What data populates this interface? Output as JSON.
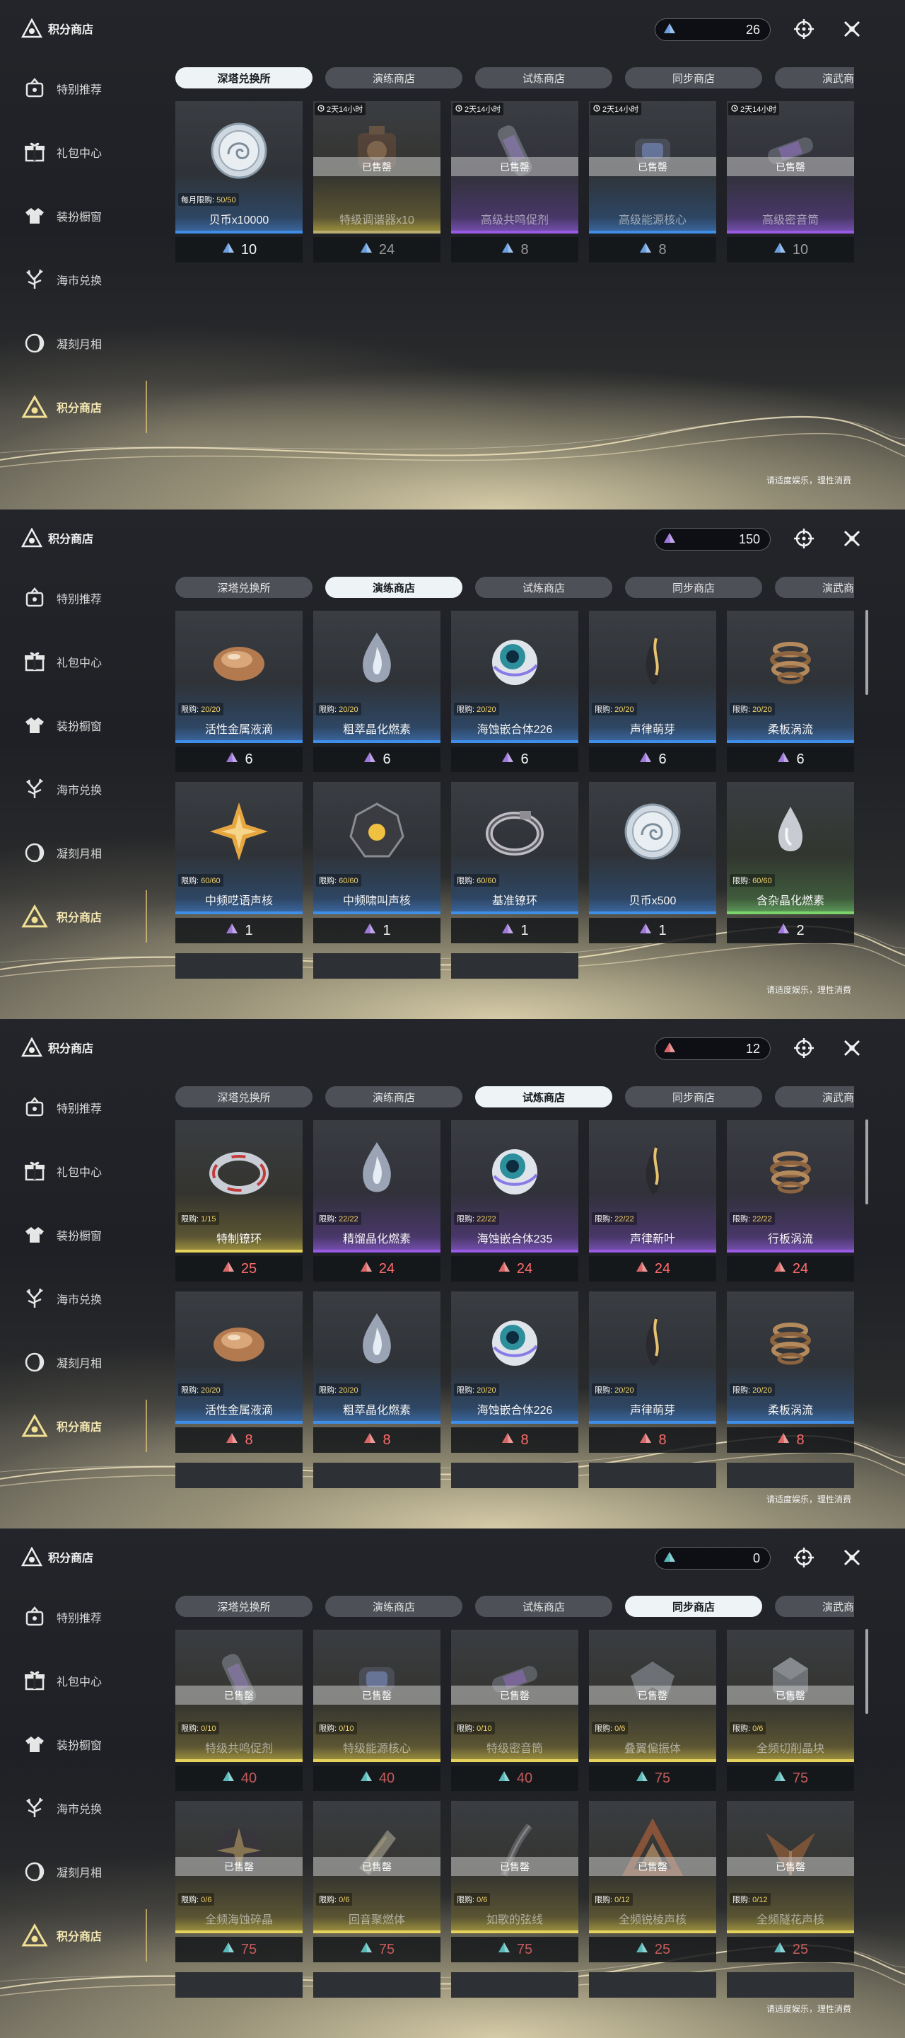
{
  "brand": {
    "title": "积分商店"
  },
  "sidebar": [
    {
      "key": "tuijian",
      "label": "特别推荐",
      "icon": "recommend-icon"
    },
    {
      "key": "libao",
      "label": "礼包中心",
      "icon": "gift-icon"
    },
    {
      "key": "zhuangban",
      "label": "装扮橱窗",
      "icon": "wardrobe-icon"
    },
    {
      "key": "haishi",
      "label": "海市兑换",
      "icon": "coral-icon"
    },
    {
      "key": "ningke",
      "label": "凝刻月相",
      "icon": "moon-phase-icon"
    },
    {
      "key": "jifen",
      "label": "积分商店",
      "icon": "points-store-icon"
    }
  ],
  "active_sidebar": "jifen",
  "tabs": [
    "深塔兑换所",
    "演练商店",
    "试炼商店",
    "同步商店",
    "演武商店"
  ],
  "footnote": "请适度娱乐，理性消费",
  "limit_label": "限购:",
  "sold_out_label": "已售罄",
  "panels": [
    {
      "currency": {
        "value": "26",
        "color": "#6fa6ec",
        "icon": "crystal-blue-icon"
      },
      "active_tab": 0,
      "has_scrollbar": false,
      "items": [
        {
          "name": "贝币x10000",
          "limit_prefix": "每月限购:",
          "limit": "50/50",
          "price": "10",
          "tint": "blue",
          "icon": "coin-icon",
          "sold": false
        },
        {
          "name": "特级调谐器x10",
          "timer": "2天14小时",
          "price": "24",
          "tint": "gray",
          "icon": "tuner-icon",
          "sold": true
        },
        {
          "name": "高级共鸣促剂",
          "timer": "2天14小时",
          "price": "8",
          "tint": "purple",
          "icon": "tube-icon",
          "sold": true
        },
        {
          "name": "高级能源核心",
          "timer": "2天14小时",
          "price": "8",
          "tint": "blue",
          "icon": "core-icon",
          "sold": true
        },
        {
          "name": "高级密音筒",
          "timer": "2天14小时",
          "price": "10",
          "tint": "purple",
          "icon": "cylinder-icon",
          "sold": true
        }
      ]
    },
    {
      "currency": {
        "value": "150",
        "color": "#a77de6",
        "icon": "crystal-purple-icon"
      },
      "active_tab": 1,
      "has_scrollbar": true,
      "items": [
        {
          "name": "活性金属液滴",
          "limit": "20/20",
          "price": "6",
          "tint": "blue",
          "icon": "metal-drop-icon"
        },
        {
          "name": "粗萃晶化燃素",
          "limit": "20/20",
          "price": "6",
          "tint": "blue",
          "icon": "flame-drop-icon"
        },
        {
          "name": "海蚀嵌合体226",
          "limit": "20/20",
          "price": "6",
          "tint": "blue",
          "icon": "orb-icon"
        },
        {
          "name": "声律萌芽",
          "limit": "20/20",
          "price": "6",
          "tint": "blue",
          "icon": "sprout-icon"
        },
        {
          "name": "柔板涡流",
          "limit": "20/20",
          "price": "6",
          "tint": "blue",
          "icon": "vortex-icon"
        },
        {
          "name": "中频呓语声核",
          "limit": "60/60",
          "price": "1",
          "tint": "blue",
          "icon": "star-core-icon"
        },
        {
          "name": "中频啸叫声核",
          "limit": "60/60",
          "price": "1",
          "tint": "blue",
          "icon": "dark-core-icon"
        },
        {
          "name": "基准镣环",
          "limit": "60/60",
          "price": "1",
          "tint": "blue",
          "icon": "ring-icon"
        },
        {
          "name": "贝币x500",
          "limit": "",
          "price": "1",
          "tint": "blue",
          "icon": "coin-icon"
        },
        {
          "name": "含杂晶化燃素",
          "limit": "60/60",
          "price": "2",
          "tint": "green",
          "icon": "drop-icon"
        }
      ],
      "stubs": 3
    },
    {
      "currency": {
        "value": "12",
        "color": "#e66a6a",
        "icon": "crystal-red-icon"
      },
      "active_tab": 2,
      "has_scrollbar": true,
      "items": [
        {
          "name": "特制镣环",
          "limit": "1/15",
          "price": "25",
          "tint": "gold",
          "icon": "cuff-icon",
          "red": true
        },
        {
          "name": "精馏晶化燃素",
          "limit": "22/22",
          "price": "24",
          "tint": "purple",
          "icon": "flame-drop-icon",
          "red": true
        },
        {
          "name": "海蚀嵌合体235",
          "limit": "22/22",
          "price": "24",
          "tint": "purple",
          "icon": "orb-icon",
          "red": true
        },
        {
          "name": "声律新叶",
          "limit": "22/22",
          "price": "24",
          "tint": "purple",
          "icon": "sprout-icon",
          "red": true
        },
        {
          "name": "行板涡流",
          "limit": "22/22",
          "price": "24",
          "tint": "purple",
          "icon": "vortex-icon",
          "red": true
        },
        {
          "name": "活性金属液滴",
          "limit": "20/20",
          "price": "8",
          "tint": "blue",
          "icon": "metal-drop-icon",
          "red": true
        },
        {
          "name": "粗萃晶化燃素",
          "limit": "20/20",
          "price": "8",
          "tint": "blue",
          "icon": "flame-drop-icon",
          "red": true
        },
        {
          "name": "海蚀嵌合体226",
          "limit": "20/20",
          "price": "8",
          "tint": "blue",
          "icon": "orb-icon",
          "red": true
        },
        {
          "name": "声律萌芽",
          "limit": "20/20",
          "price": "8",
          "tint": "blue",
          "icon": "sprout-icon",
          "red": true
        },
        {
          "name": "柔板涡流",
          "limit": "20/20",
          "price": "8",
          "tint": "blue",
          "icon": "vortex-icon",
          "red": true
        }
      ],
      "stubs": 5
    },
    {
      "currency": {
        "value": "0",
        "color": "#5cc3c4",
        "icon": "crystal-teal-icon"
      },
      "active_tab": 3,
      "has_scrollbar": true,
      "items": [
        {
          "name": "特级共鸣促剂",
          "limit": "0/10",
          "price": "40",
          "tint": "gold",
          "icon": "tube-icon",
          "sold": true,
          "red": true
        },
        {
          "name": "特级能源核心",
          "limit": "0/10",
          "price": "40",
          "tint": "gold",
          "icon": "core-icon",
          "sold": true,
          "red": true
        },
        {
          "name": "特级密音筒",
          "limit": "0/10",
          "price": "40",
          "tint": "gold",
          "icon": "cylinder-icon",
          "sold": true,
          "red": true
        },
        {
          "name": "叠翼偏振体",
          "limit": "0/6",
          "price": "75",
          "tint": "gold",
          "icon": "wing-icon",
          "sold": true,
          "red": true
        },
        {
          "name": "全频切削晶块",
          "limit": "0/6",
          "price": "75",
          "tint": "gold",
          "icon": "crystal-block-icon",
          "sold": true,
          "red": true
        },
        {
          "name": "全频海蚀碎晶",
          "limit": "0/6",
          "price": "75",
          "tint": "gold",
          "icon": "shard-icon",
          "sold": true,
          "red": true
        },
        {
          "name": "回音聚燃体",
          "limit": "0/6",
          "price": "75",
          "tint": "gold",
          "icon": "flame-body-icon",
          "sold": true,
          "red": true
        },
        {
          "name": "如歌的弦线",
          "limit": "0/6",
          "price": "75",
          "tint": "gold",
          "icon": "string-icon",
          "sold": true,
          "red": true
        },
        {
          "name": "全频锐棱声核",
          "limit": "0/12",
          "price": "25",
          "tint": "gold",
          "icon": "prism-core-icon",
          "sold": true,
          "red": true
        },
        {
          "name": "全频隧花声核",
          "limit": "0/12",
          "price": "25",
          "tint": "gold",
          "icon": "flower-core-icon",
          "sold": true,
          "red": true
        }
      ],
      "stubs": 5
    }
  ]
}
